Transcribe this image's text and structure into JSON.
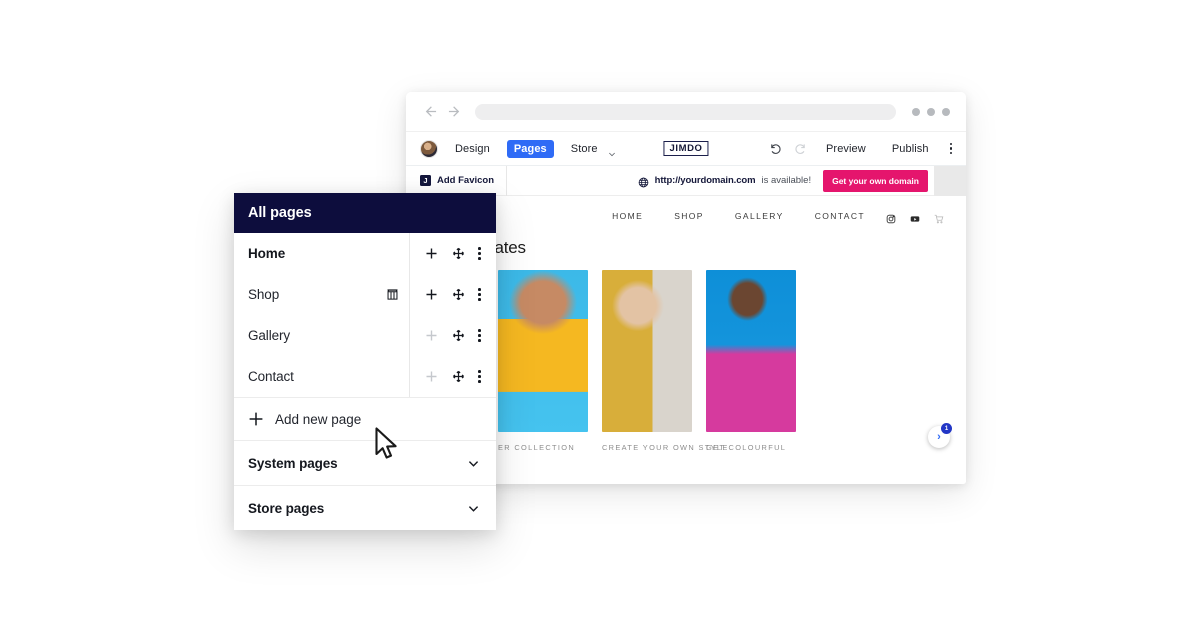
{
  "browser": {
    "back_icon": "arrow-left-icon",
    "forward_icon": "arrow-right-icon",
    "url_value": "",
    "window_dots": 3
  },
  "toolbar": {
    "avatar": "user-avatar",
    "design_label": "Design",
    "pages_label": "Pages",
    "store_label": "Store",
    "brand_label": "JIMDO",
    "undo_icon": "undo-icon",
    "redo_icon": "redo-icon",
    "preview_label": "Preview",
    "publish_label": "Publish",
    "more_icon": "kebab-menu-icon",
    "accent_blue": "#2f6bf6"
  },
  "strip": {
    "favicon_label": "Add Favicon",
    "favicon_letter": "J",
    "globe_icon": "globe-icon",
    "domain_url": "http://yourdomain.com",
    "domain_available": "is available!",
    "domain_cta": "Get your own domain",
    "cta_color": "#e5156d"
  },
  "site": {
    "nav": [
      {
        "label": "HOME"
      },
      {
        "label": "SHOP"
      },
      {
        "label": "GALLERY"
      },
      {
        "label": "CONTACT"
      }
    ],
    "social": [
      {
        "name": "instagram-icon"
      },
      {
        "name": "youtube-icon"
      },
      {
        "name": "cart-icon"
      }
    ],
    "heading": "odates",
    "cards": [
      {
        "caption": "ER COLLECTION"
      },
      {
        "caption": "CREATE YOUR OWN STYLE"
      },
      {
        "caption": "GET COLOURFUL"
      }
    ],
    "chat_arrow": "›",
    "chat_badge": "1"
  },
  "sidebar": {
    "title": "All pages",
    "header_color": "#0d0d3d",
    "pages": [
      {
        "name": "Home",
        "bold": true,
        "badge": null,
        "add_enabled": true
      },
      {
        "name": "Shop",
        "bold": false,
        "badge": "shop-icon",
        "add_enabled": true
      },
      {
        "name": "Gallery",
        "bold": false,
        "badge": null,
        "add_enabled": false
      },
      {
        "name": "Contact",
        "bold": false,
        "badge": null,
        "add_enabled": false
      }
    ],
    "add_new_label": "Add new page",
    "groups": [
      {
        "label": "System pages"
      },
      {
        "label": "Store pages"
      }
    ]
  }
}
